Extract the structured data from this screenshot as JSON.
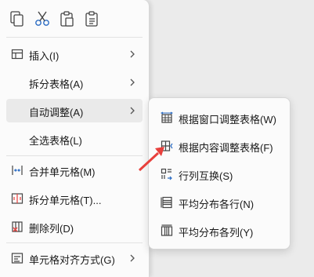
{
  "toolbar": {
    "icons": [
      "copy-icon",
      "cut-icon",
      "paste-icon",
      "paste-special-icon"
    ]
  },
  "context_menu": {
    "items": [
      {
        "label": "插入(I)",
        "icon": "insert-table-icon",
        "has_submenu": true
      },
      {
        "label": "拆分表格(A)",
        "icon": "",
        "has_submenu": true
      },
      {
        "label": "自动调整(A)",
        "icon": "",
        "has_submenu": true,
        "active": true
      },
      {
        "label": "全选表格(L)",
        "icon": "",
        "has_submenu": false
      },
      {
        "label": "合并单元格(M)",
        "icon": "merge-cells-icon",
        "has_submenu": false
      },
      {
        "label": "拆分单元格(T)...",
        "icon": "split-cells-icon",
        "has_submenu": false
      },
      {
        "label": "删除列(D)",
        "icon": "delete-column-icon",
        "has_submenu": false
      },
      {
        "label": "单元格对齐方式(G)",
        "icon": "cell-align-icon",
        "has_submenu": true
      }
    ]
  },
  "submenu": {
    "items": [
      {
        "label": "根据窗口调整表格(W)",
        "icon": "fit-window-icon"
      },
      {
        "label": "根据内容调整表格(F)",
        "icon": "fit-content-icon"
      },
      {
        "label": "行列互换(S)",
        "icon": "swap-rows-columns-icon"
      },
      {
        "label": "平均分布各行(N)",
        "icon": "distribute-rows-icon"
      },
      {
        "label": "平均分布各列(Y)",
        "icon": "distribute-columns-icon"
      }
    ]
  },
  "colors": {
    "accent": "#2b6cc4",
    "arrow": "#e8403c",
    "icon": "#444444"
  }
}
